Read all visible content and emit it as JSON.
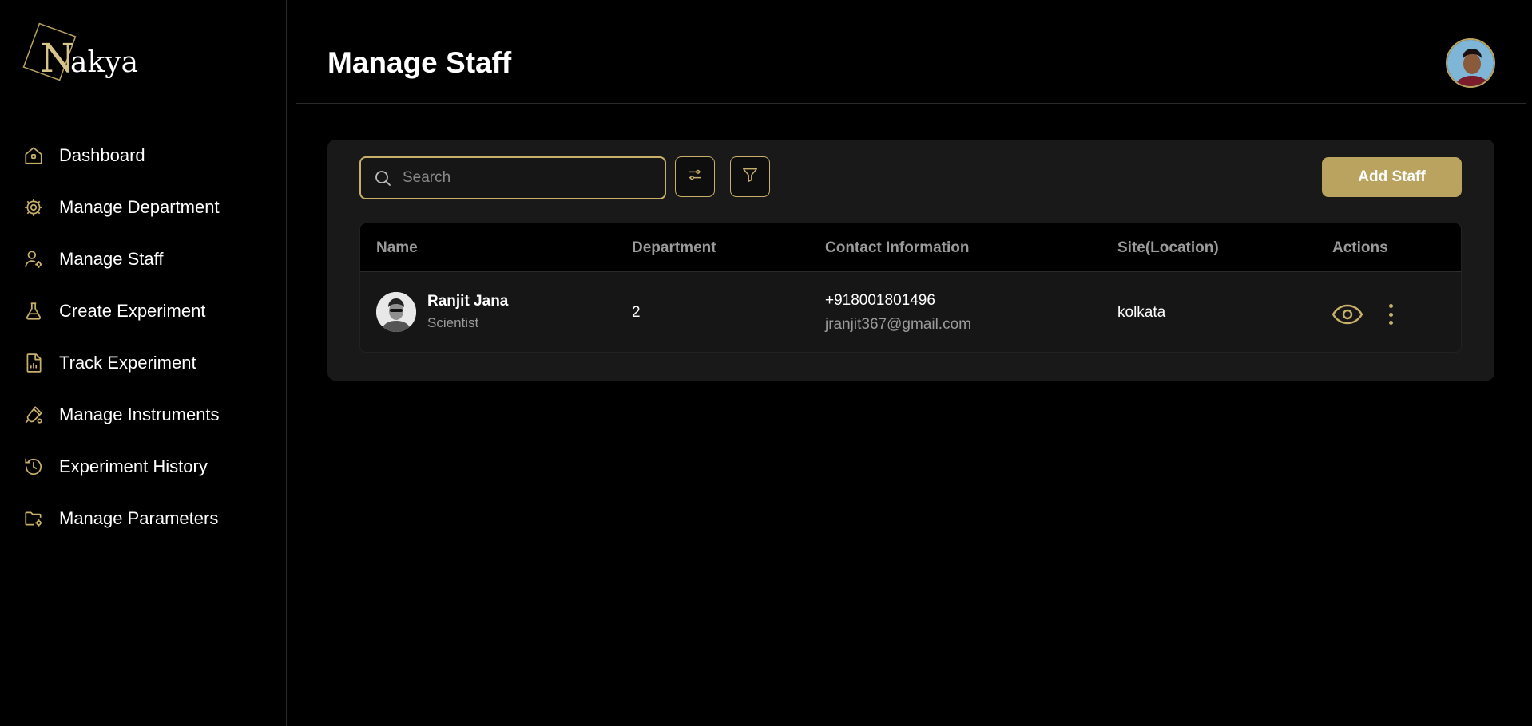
{
  "brand": {
    "logo_letter": "N",
    "logo_text": "akya",
    "accent": "#b9a35e"
  },
  "sidebar": {
    "items": [
      {
        "label": "Dashboard",
        "icon": "home-icon"
      },
      {
        "label": "Manage Department",
        "icon": "gear-icon"
      },
      {
        "label": "Manage Staff",
        "icon": "user-gear-icon"
      },
      {
        "label": "Create Experiment",
        "icon": "flask-icon"
      },
      {
        "label": "Track Experiment",
        "icon": "chart-file-icon"
      },
      {
        "label": "Manage Instruments",
        "icon": "instrument-icon"
      },
      {
        "label": "Experiment History",
        "icon": "history-icon"
      },
      {
        "label": "Manage Parameters",
        "icon": "folder-gear-icon"
      }
    ]
  },
  "header": {
    "title": "Manage Staff"
  },
  "toolbar": {
    "search_placeholder": "Search",
    "add_label": "Add Staff"
  },
  "table": {
    "columns": [
      "Name",
      "Department",
      "Contact Information",
      "Site(Location)",
      "Actions"
    ],
    "rows": [
      {
        "name": "Ranjit Jana",
        "role": "Scientist",
        "department": "2",
        "phone": "+918001801496",
        "email": "jranjit367@gmail.com",
        "site": "kolkata"
      }
    ]
  }
}
